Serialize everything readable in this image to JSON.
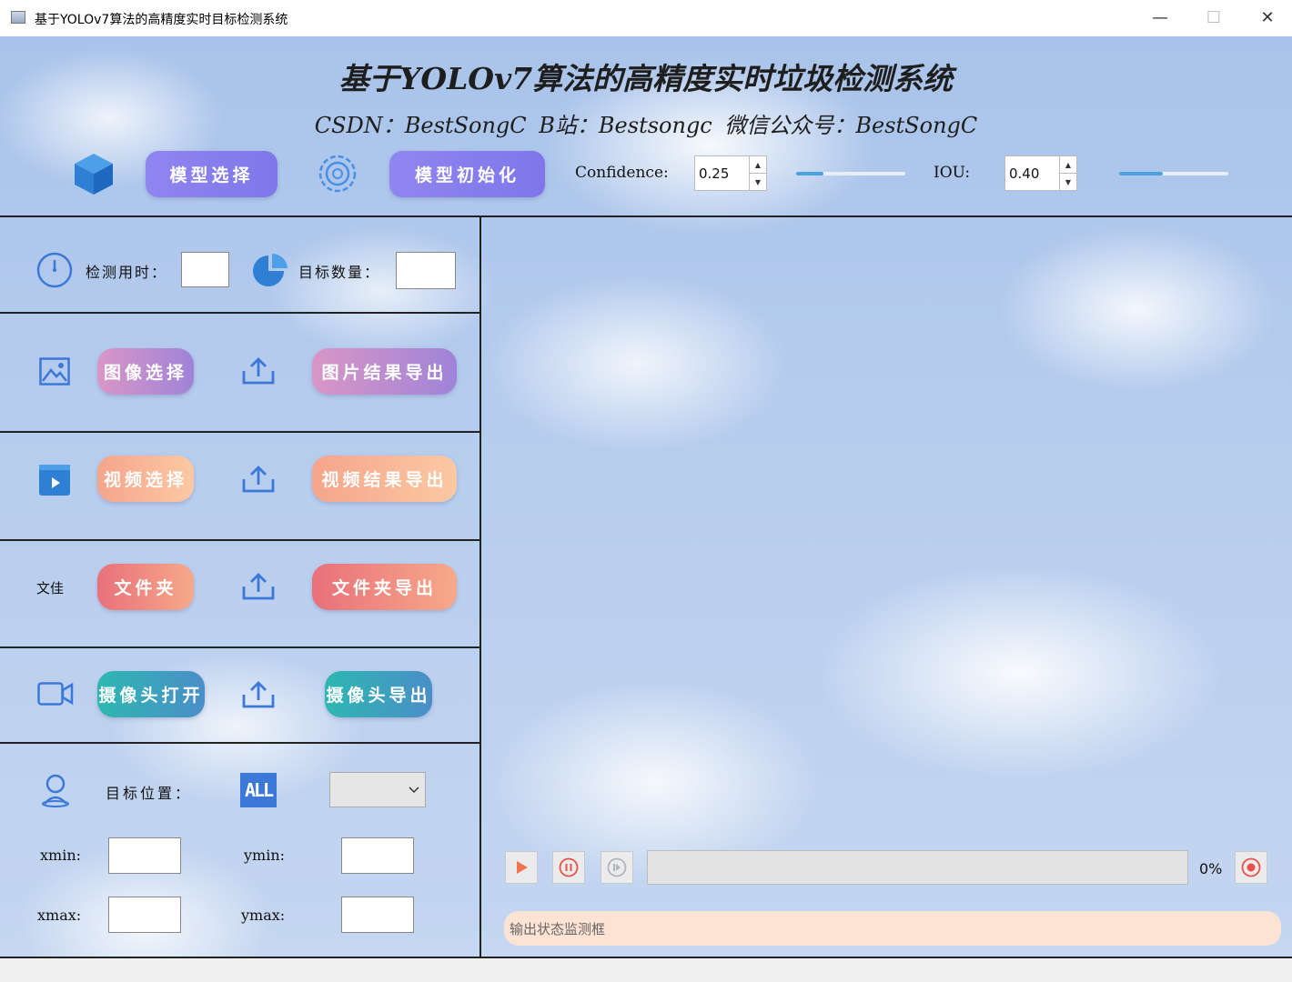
{
  "window": {
    "title": "基于YOLOv7算法的高精度实时目标检测系统",
    "minimize": "—",
    "maximize": "☐",
    "close": "✕"
  },
  "header": {
    "title": "基于YOLOv7算法的高精度实时垃圾检测系统",
    "subtitle": "CSDN：BestSongC   B站：Bestsongc   微信公众号：BestSongC"
  },
  "toolbar": {
    "model_select": "模型选择",
    "model_init": "模型初始化",
    "confidence_label": "Confidence:",
    "confidence_value": "0.25",
    "confidence_slider": 0.25,
    "iou_label": "IOU:",
    "iou_value": "0.40",
    "iou_slider": 0.4
  },
  "stats": {
    "time_label": "检测用时：",
    "time_value": "",
    "count_label": "目标数量：",
    "count_value": ""
  },
  "image_row": {
    "select": "图像选择",
    "export": "图片结果导出"
  },
  "video_row": {
    "select": "视频选择",
    "export": "视频结果导出"
  },
  "folder_row": {
    "icon_text": "文佳",
    "select": "文件夹",
    "export": "文件夹导出"
  },
  "camera_row": {
    "select": "摄像头打开",
    "export": "摄像头导出"
  },
  "position": {
    "label": "目标位置：",
    "all_badge": "ALL",
    "dropdown_value": "",
    "xmin_label": "xmin:",
    "ymin_label": "ymin:",
    "xmax_label": "xmax:",
    "ymax_label": "ymax:"
  },
  "player": {
    "progress_text": "0%",
    "progress": 0
  },
  "status": {
    "placeholder": "输出状态监测框"
  },
  "colors": {
    "accent": "#4aa3df",
    "icon_blue": "#3b78d8",
    "record_red": "#e9504a"
  },
  "icons": [
    "cube-icon",
    "target-icon",
    "clock-icon",
    "pie-chart-icon",
    "image-icon",
    "upload-icon",
    "video-file-icon",
    "camera-icon",
    "location-person-icon",
    "play-icon",
    "pause-icon",
    "stop-icon",
    "record-icon"
  ]
}
